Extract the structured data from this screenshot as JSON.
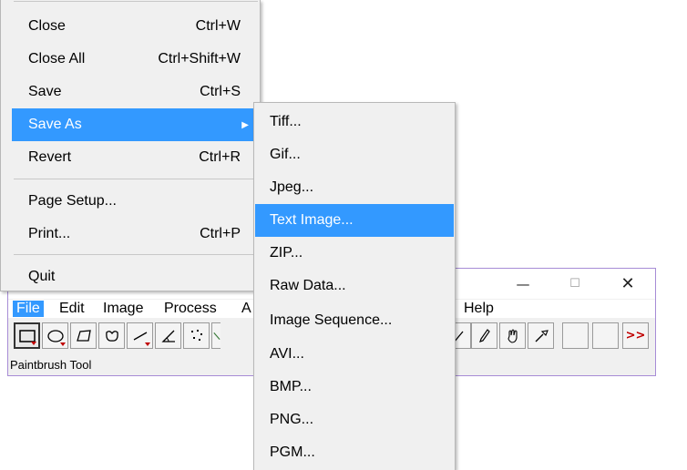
{
  "window": {
    "min_icon": "—",
    "max_icon": "☐",
    "close_icon": "✕"
  },
  "menubar": {
    "file": "File",
    "edit": "Edit",
    "image": "Image",
    "process": "Process",
    "analyze_partial": "A",
    "help": "Help"
  },
  "toolbar": {
    "more": ">>"
  },
  "status": "Paintbrush Tool",
  "file_menu": {
    "close": {
      "label": "Close",
      "shortcut": "Ctrl+W"
    },
    "close_all": {
      "label": "Close All",
      "shortcut": "Ctrl+Shift+W"
    },
    "save": {
      "label": "Save",
      "shortcut": "Ctrl+S"
    },
    "save_as": {
      "label": "Save As",
      "arrow": "▶"
    },
    "revert": {
      "label": "Revert",
      "shortcut": "Ctrl+R"
    },
    "page_setup": {
      "label": "Page Setup..."
    },
    "print": {
      "label": "Print...",
      "shortcut": "Ctrl+P"
    },
    "quit": {
      "label": "Quit"
    }
  },
  "save_as_menu": [
    "Tiff...",
    "Gif...",
    "Jpeg...",
    "Text Image...",
    "ZIP...",
    "Raw Data...",
    "Image Sequence...",
    "AVI...",
    "BMP...",
    "PNG...",
    "PGM..."
  ],
  "colors": {
    "highlight": "#3399ff",
    "window_border": "#a78cd6",
    "menu_bg": "#f0f0f0"
  }
}
